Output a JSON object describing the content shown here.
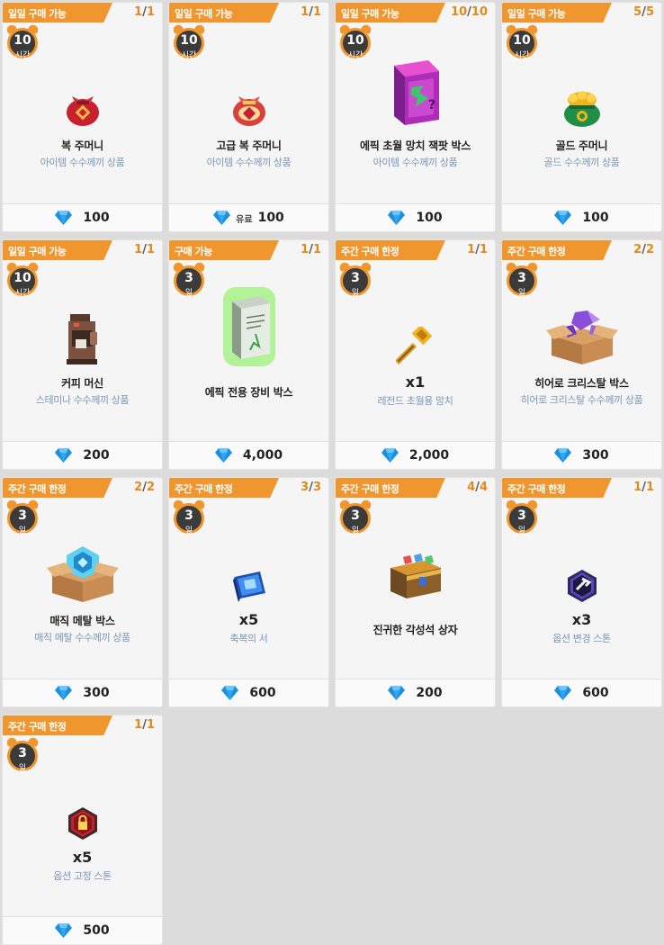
{
  "cards": [
    {
      "tag": "일일 구매 가능",
      "count_used": "1",
      "count_total": "1",
      "timer_num": "10",
      "timer_unit": "시간",
      "icon": "lucky-pouch-red-icon",
      "name": "복 주머니",
      "qty": "",
      "desc": "아이템 수수께끼 상품",
      "price_unit": "",
      "price": "100"
    },
    {
      "tag": "일일 구매 가능",
      "count_used": "1",
      "count_total": "1",
      "timer_num": "10",
      "timer_unit": "시간",
      "icon": "premium-lucky-pouch-icon",
      "name": "고급 복 주머니",
      "qty": "",
      "desc": "아이템 수수께끼 상품",
      "price_unit": "유료",
      "price": "100"
    },
    {
      "tag": "일일 구매 가능",
      "count_used": "10",
      "count_total": "10",
      "timer_num": "10",
      "timer_unit": "시간",
      "icon": "epic-hammer-random-box-icon",
      "name": "에픽 초월 망치 잭팟 박스",
      "qty": "",
      "desc": "아이템 수수께끼 상품",
      "price_unit": "",
      "price": "100"
    },
    {
      "tag": "일일 구매 가능",
      "count_used": "5",
      "count_total": "5",
      "timer_num": "10",
      "timer_unit": "시간",
      "icon": "gold-pouch-icon",
      "name": "골드 주머니",
      "qty": "",
      "desc": "골드 수수께끼 상품",
      "price_unit": "",
      "price": "100"
    },
    {
      "tag": "일일 구매 가능",
      "count_used": "1",
      "count_total": "1",
      "timer_num": "10",
      "timer_unit": "시간",
      "icon": "coffee-machine-icon",
      "name": "커피 머신",
      "qty": "",
      "desc": "스테미나 수수께끼 상품",
      "price_unit": "",
      "price": "200"
    },
    {
      "tag": "구매 가능",
      "count_used": "1",
      "count_total": "1",
      "timer_num": "3",
      "timer_unit": "일",
      "icon": "epic-equipment-box-icon",
      "name": "에픽 전용 장비 박스",
      "qty": "",
      "desc": "",
      "price_unit": "",
      "price": "4,000"
    },
    {
      "tag": "주간 구매 한정",
      "count_used": "1",
      "count_total": "1",
      "timer_num": "3",
      "timer_unit": "일",
      "icon": "legendary-hammer-icon",
      "name": "",
      "qty": "x1",
      "desc": "레전드 초월용 망치",
      "price_unit": "",
      "price": "2,000"
    },
    {
      "tag": "주간 구매 한정",
      "count_used": "2",
      "count_total": "2",
      "timer_num": "3",
      "timer_unit": "일",
      "icon": "hero-crystal-box-icon",
      "name": "히어로 크리스탈 박스",
      "qty": "",
      "desc": "히어로 크리스탈 수수께끼 상품",
      "price_unit": "",
      "price": "300"
    },
    {
      "tag": "주간 구매 한정",
      "count_used": "2",
      "count_total": "2",
      "timer_num": "3",
      "timer_unit": "일",
      "icon": "magic-metal-box-icon",
      "name": "매직 메탈 박스",
      "qty": "",
      "desc": "매직 메탈 수수께끼 상품",
      "price_unit": "",
      "price": "300"
    },
    {
      "tag": "주간 구매 한정",
      "count_used": "3",
      "count_total": "3",
      "timer_num": "3",
      "timer_unit": "일",
      "icon": "blessing-book-icon",
      "name": "",
      "qty": "x5",
      "desc": "축복의 서",
      "price_unit": "",
      "price": "600"
    },
    {
      "tag": "주간 구매 한정",
      "count_used": "4",
      "count_total": "4",
      "timer_num": "3",
      "timer_unit": "일",
      "icon": "awakening-stone-chest-icon",
      "name": "진귀한 각성석 상자",
      "qty": "",
      "desc": "",
      "price_unit": "",
      "price": "200"
    },
    {
      "tag": "주간 구매 한정",
      "count_used": "1",
      "count_total": "1",
      "timer_num": "3",
      "timer_unit": "일",
      "icon": "option-change-stone-icon",
      "name": "",
      "qty": "x3",
      "desc": "옵션 변경 스톤",
      "price_unit": "",
      "price": "600"
    },
    {
      "tag": "주간 구매 한정",
      "count_used": "1",
      "count_total": "1",
      "timer_num": "3",
      "timer_unit": "일",
      "icon": "option-lock-stone-icon",
      "name": "",
      "qty": "x5",
      "desc": "옵션 고정 스톤",
      "price_unit": "",
      "price": "500"
    }
  ],
  "colors": {
    "accent": "#f0962e",
    "desc": "#7a97b8",
    "gem": "#1a8fe0"
  }
}
